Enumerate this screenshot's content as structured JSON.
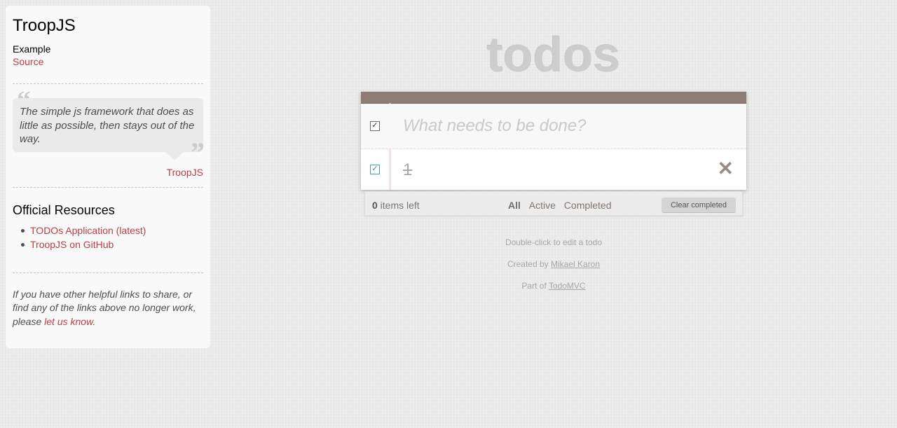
{
  "sidebar": {
    "title": "TroopJS",
    "example_label": "Example",
    "source_link": "Source",
    "quote_open_mark": "“",
    "quote_close_mark": "”",
    "quote_text": "The simple js framework that does as little as possible, then stays out of the way.",
    "quote_author": "TroopJS",
    "resources_heading": "Official Resources",
    "resources": [
      {
        "label": "TODOs Application (latest)"
      },
      {
        "label": "TroopJS on GitHub"
      }
    ],
    "footer_prefix": "If you have other helpful links to share, or find any of the links above no longer work, please ",
    "footer_link": "let us know",
    "footer_suffix": "."
  },
  "app": {
    "title": "todos",
    "new_todo_placeholder": "What needs to be done?",
    "toggle_all_checked": true,
    "todos": [
      {
        "title": "1",
        "completed": true
      }
    ],
    "destroy_glyph": "✕",
    "checkbox_glyph": "✓",
    "footer": {
      "count_number": "0",
      "count_text": " items left",
      "filters": {
        "all": "All",
        "active": "Active",
        "completed": "Completed"
      },
      "selected_filter": "All",
      "clear_completed": "Clear completed"
    }
  },
  "info": {
    "edit_hint": "Double-click to edit a todo",
    "created_prefix": "Created by ",
    "created_author": "Mikael Karon",
    "part_prefix": "Part of ",
    "part_link": "TodoMVC"
  },
  "colors": {
    "accent_link": "#b83f45",
    "header_bar": "#8d7d77",
    "title_text": "#cdcdcd"
  }
}
